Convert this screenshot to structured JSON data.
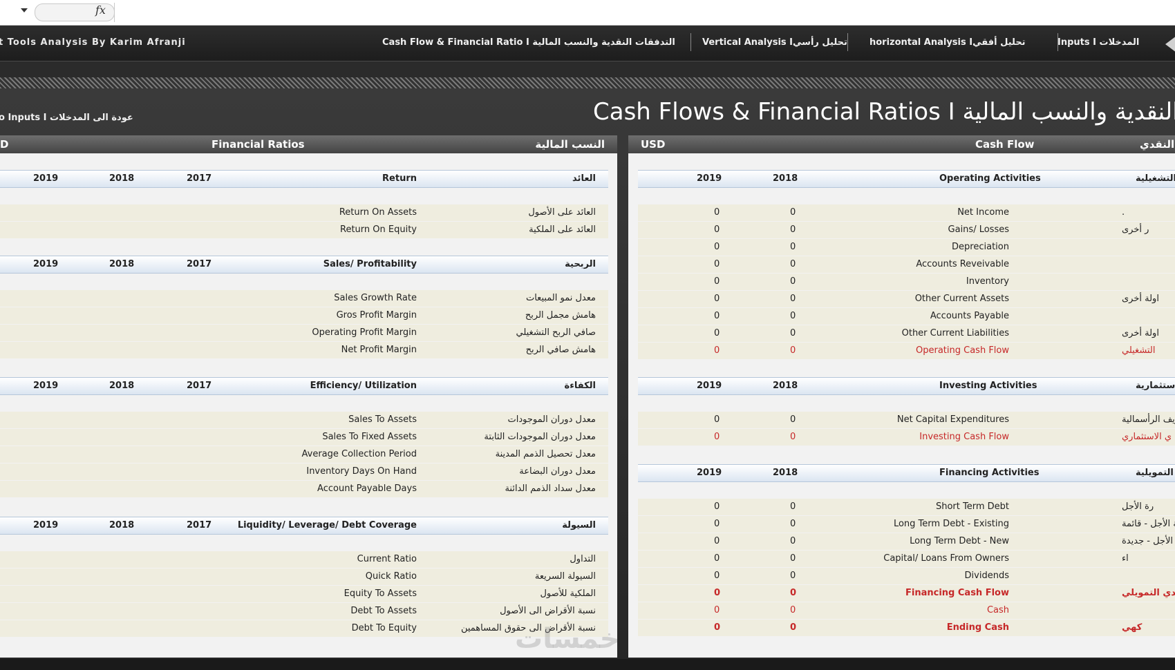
{
  "formula_bar": {
    "fx_label": "fx"
  },
  "nav": {
    "app_title": "t Tools Analysis By Karim Afranji",
    "tabs": [
      {
        "label": "Cash Flow & Financial Ratio I التدفقات النقدية والنسب المالية"
      },
      {
        "label": "Vertical Analysis Iتحليل رأسي"
      },
      {
        "label": "horizontal Analysis Iتحليل أفقي"
      },
      {
        "label": "Inputs I المدخلات"
      }
    ]
  },
  "page": {
    "title": "Cash Flows &  Financial Ratios I قات النقدية والنسب المالية",
    "back_link": "o Inputs I عودة الى المدخلات"
  },
  "left_panel": {
    "currency": "D",
    "title_en": "Financial Ratios",
    "title_ar": "النسب المالية",
    "sections": [
      {
        "name_en": "Return",
        "name_ar": "العائد",
        "years": [
          "2019",
          "2018",
          "2017"
        ],
        "rows": [
          {
            "en": "Return On Assets",
            "ar": "العائد على الأصول"
          },
          {
            "en": "Return On Equity",
            "ar": "العائد على الملكية"
          }
        ]
      },
      {
        "name_en": "Sales/ Profitability",
        "name_ar": "الربحية",
        "years": [
          "2019",
          "2018",
          "2017"
        ],
        "rows": [
          {
            "en": "Sales Growth Rate",
            "ar": "معدل نمو المبيعات"
          },
          {
            "en": "Gros Profit Margin",
            "ar": "هامش مجمل الربح"
          },
          {
            "en": "Operating Profit Margin",
            "ar": "صافي الربح التشغيلي"
          },
          {
            "en": "Net Profit Margin",
            "ar": "هامش صافي الربح"
          }
        ]
      },
      {
        "name_en": "Efficiency/ Utilization",
        "name_ar": "الكفاءة",
        "years": [
          "2019",
          "2018",
          "2017"
        ],
        "rows": [
          {
            "en": "Sales To Assets",
            "ar": "معدل دوران الموجودات"
          },
          {
            "en": "Sales To Fixed Assets",
            "ar": "معدل دوران الموجودات الثابتة"
          },
          {
            "en": "Average Collection Period",
            "ar": "معدل تحصيل الذمم المدينة"
          },
          {
            "en": "Inventory Days On Hand",
            "ar": "معدل دوران البضاعة"
          },
          {
            "en": "Account Payable Days",
            "ar": "معدل سداد الذمم الدائنة"
          }
        ]
      },
      {
        "name_en": "Liquidity/ Leverage/ Debt Coverage",
        "name_ar": "السيولة",
        "years": [
          "2019",
          "2018",
          "2017"
        ],
        "rows": [
          {
            "en": "Current Ratio",
            "ar": "التداول"
          },
          {
            "en": "Quick Ratio",
            "ar": "السيولة السريعة"
          },
          {
            "en": "Equity To Assets",
            "ar": "الملكية للأصول"
          },
          {
            "en": "Debt To Assets",
            "ar": "نسبة الأقراض الى الأصول"
          },
          {
            "en": "Debt To Equity",
            "ar": "نسبة الأقراض الى حقوق المساهمين"
          }
        ]
      }
    ]
  },
  "right_panel": {
    "currency": "USD",
    "title_en": "Cash Flow",
    "title_ar": "النقدي",
    "sections": [
      {
        "name_en": "Operating Activities",
        "name_ar": "التشغيلية",
        "years": [
          "2019",
          "2018"
        ],
        "rows": [
          {
            "en": "Net Income",
            "ar": ".",
            "v2019": "0",
            "v2018": "0"
          },
          {
            "en": "Gains/ Losses",
            "ar": "ر أخرى",
            "v2019": "0",
            "v2018": "0"
          },
          {
            "en": "Depreciation",
            "ar": "",
            "v2019": "0",
            "v2018": "0"
          },
          {
            "en": "Accounts Reveivable",
            "ar": "",
            "v2019": "0",
            "v2018": "0"
          },
          {
            "en": "Inventory",
            "ar": "",
            "v2019": "0",
            "v2018": "0"
          },
          {
            "en": "Other Current Assets",
            "ar": "اولة أخرى",
            "v2019": "0",
            "v2018": "0"
          },
          {
            "en": "Accounts Payable",
            "ar": "",
            "v2019": "0",
            "v2018": "0"
          },
          {
            "en": "Other Current Liabilities",
            "ar": "اولة أخرى",
            "v2019": "0",
            "v2018": "0"
          },
          {
            "en": "Operating Cash Flow",
            "ar": "التشغيلي",
            "v2019": "0",
            "v2018": "0"
          }
        ]
      },
      {
        "name_en": "Investing Activities",
        "name_ar": "الاستثمارية",
        "years": [
          "2019",
          "2018"
        ],
        "rows": [
          {
            "en": "Net Capital Expenditures",
            "ar": "اريف الرأسمالية",
            "v2019": "0",
            "v2018": "0"
          },
          {
            "en": "Investing Cash Flow",
            "ar": "ي الاستثماري",
            "v2019": "0",
            "v2018": "0"
          }
        ]
      },
      {
        "name_en": "Financing Activities",
        "name_ar": "التمويلية",
        "years": [
          "2019",
          "2018"
        ],
        "rows": [
          {
            "en": "Short Term Debt",
            "ar": "رة الأجل",
            "v2019": "0",
            "v2018": "0"
          },
          {
            "en": "Long Term Debt - Existing",
            "ar": "ض طويلة الأجل - قائمة",
            "v2019": "0",
            "v2018": "0"
          },
          {
            "en": "Long Term Debt - New",
            "ar": "ض طويلة الأجل - جديدة",
            "v2019": "0",
            "v2018": "0"
          },
          {
            "en": "Capital/ Loans From Owners",
            "ar": "اء",
            "v2019": "0",
            "v2018": "0"
          },
          {
            "en": "Dividends",
            "ar": "",
            "v2019": "0",
            "v2018": "0"
          },
          {
            "en": "Financing Cash Flow",
            "ar": "قدي التمويلي",
            "v2019": "0",
            "v2018": "0"
          },
          {
            "en": "Cash",
            "ar": "",
            "v2019": "0",
            "v2018": "0"
          },
          {
            "en": "Ending Cash",
            "ar": "كهي",
            "v2019": "0",
            "v2018": "0"
          }
        ]
      }
    ]
  },
  "watermark": "خمسات",
  "colors": {
    "accent_red": "#c62828",
    "header_blue": "#dbe5f1",
    "cream": "#efeddf"
  }
}
